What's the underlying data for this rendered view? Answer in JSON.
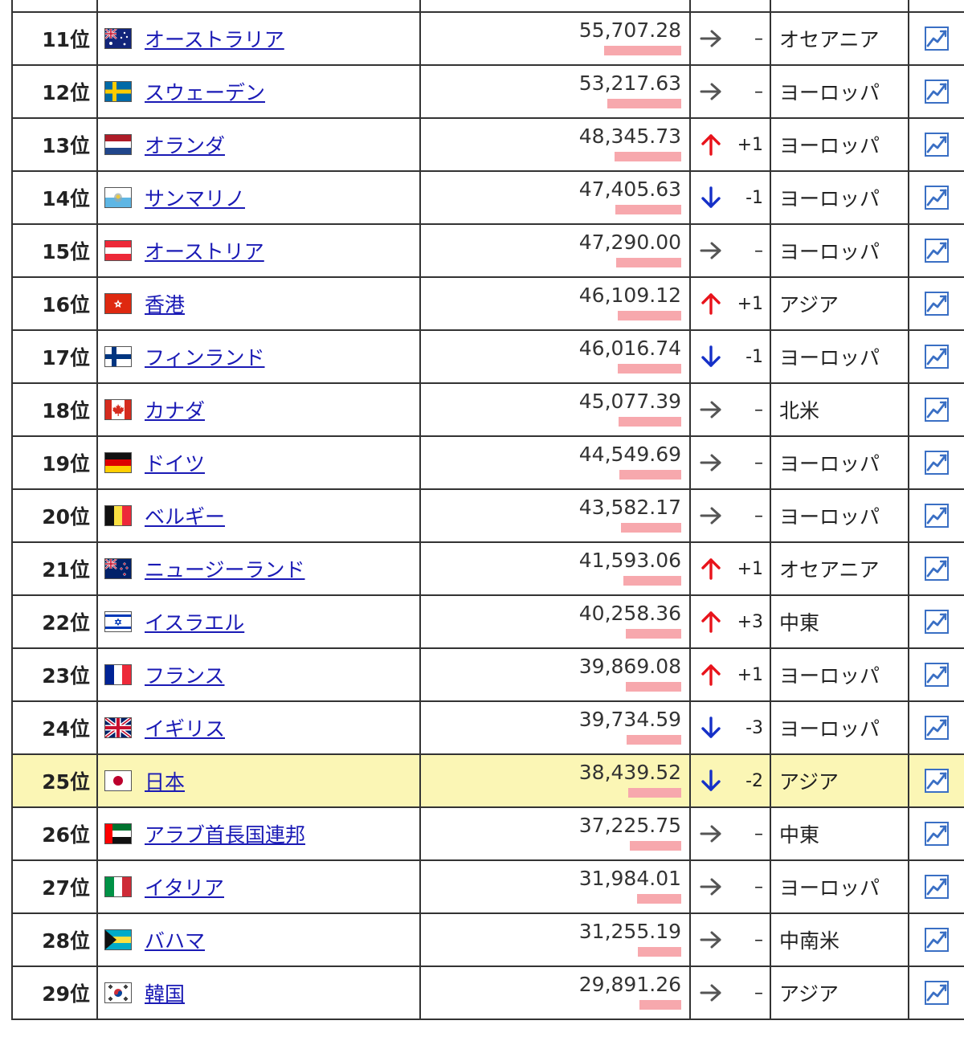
{
  "table": {
    "rows": [
      {
        "rank": "",
        "country": "",
        "value": "",
        "bar_pct": 0,
        "trend": "",
        "change": "",
        "region": "",
        "flag": "",
        "partial": true
      },
      {
        "rank": "11位",
        "country": "オーストラリア",
        "value": "55,707.28",
        "bar_pct": 100,
        "trend": "same",
        "change": "–",
        "region": "オセアニア",
        "flag": "australia-flag-icon"
      },
      {
        "rank": "12位",
        "country": "スウェーデン",
        "value": "53,217.63",
        "bar_pct": 95.5,
        "trend": "same",
        "change": "–",
        "region": "ヨーロッパ",
        "flag": "sweden-flag-icon"
      },
      {
        "rank": "13位",
        "country": "オランダ",
        "value": "48,345.73",
        "bar_pct": 86.8,
        "trend": "up",
        "change": "+1",
        "region": "ヨーロッパ",
        "flag": "netherlands-flag-icon"
      },
      {
        "rank": "14位",
        "country": "サンマリノ",
        "value": "47,405.63",
        "bar_pct": 85.1,
        "trend": "down",
        "change": "-1",
        "region": "ヨーロッパ",
        "flag": "san-marino-flag-icon"
      },
      {
        "rank": "15位",
        "country": "オーストリア",
        "value": "47,290.00",
        "bar_pct": 84.9,
        "trend": "same",
        "change": "–",
        "region": "ヨーロッパ",
        "flag": "austria-flag-icon"
      },
      {
        "rank": "16位",
        "country": "香港",
        "value": "46,109.12",
        "bar_pct": 82.8,
        "trend": "up",
        "change": "+1",
        "region": "アジア",
        "flag": "hong-kong-flag-icon"
      },
      {
        "rank": "17位",
        "country": "フィンランド",
        "value": "46,016.74",
        "bar_pct": 82.6,
        "trend": "down",
        "change": "-1",
        "region": "ヨーロッパ",
        "flag": "finland-flag-icon"
      },
      {
        "rank": "18位",
        "country": "カナダ",
        "value": "45,077.39",
        "bar_pct": 80.9,
        "trend": "same",
        "change": "–",
        "region": "北米",
        "flag": "canada-flag-icon"
      },
      {
        "rank": "19位",
        "country": "ドイツ",
        "value": "44,549.69",
        "bar_pct": 80.0,
        "trend": "same",
        "change": "–",
        "region": "ヨーロッパ",
        "flag": "germany-flag-icon"
      },
      {
        "rank": "20位",
        "country": "ベルギー",
        "value": "43,582.17",
        "bar_pct": 78.2,
        "trend": "same",
        "change": "–",
        "region": "ヨーロッパ",
        "flag": "belgium-flag-icon"
      },
      {
        "rank": "21位",
        "country": "ニュージーランド",
        "value": "41,593.06",
        "bar_pct": 74.7,
        "trend": "up",
        "change": "+1",
        "region": "オセアニア",
        "flag": "new-zealand-flag-icon"
      },
      {
        "rank": "22位",
        "country": "イスラエル",
        "value": "40,258.36",
        "bar_pct": 72.3,
        "trend": "up",
        "change": "+3",
        "region": "中東",
        "flag": "israel-flag-icon"
      },
      {
        "rank": "23位",
        "country": "フランス",
        "value": "39,869.08",
        "bar_pct": 71.6,
        "trend": "up",
        "change": "+1",
        "region": "ヨーロッパ",
        "flag": "france-flag-icon"
      },
      {
        "rank": "24位",
        "country": "イギリス",
        "value": "39,734.59",
        "bar_pct": 71.3,
        "trend": "down",
        "change": "-3",
        "region": "ヨーロッパ",
        "flag": "uk-flag-icon"
      },
      {
        "rank": "25位",
        "country": "日本",
        "value": "38,439.52",
        "bar_pct": 69.0,
        "trend": "down",
        "change": "-2",
        "region": "アジア",
        "flag": "japan-flag-icon",
        "highlight": true
      },
      {
        "rank": "26位",
        "country": "アラブ首長国連邦",
        "value": "37,225.75",
        "bar_pct": 66.8,
        "trend": "same",
        "change": "–",
        "region": "中東",
        "flag": "uae-flag-icon"
      },
      {
        "rank": "27位",
        "country": "イタリア",
        "value": "31,984.01",
        "bar_pct": 57.4,
        "trend": "same",
        "change": "–",
        "region": "ヨーロッパ",
        "flag": "italy-flag-icon"
      },
      {
        "rank": "28位",
        "country": "バハマ",
        "value": "31,255.19",
        "bar_pct": 56.1,
        "trend": "same",
        "change": "–",
        "region": "中南米",
        "flag": "bahamas-flag-icon"
      },
      {
        "rank": "29位",
        "country": "韓国",
        "value": "29,891.26",
        "bar_pct": 53.7,
        "trend": "same",
        "change": "–",
        "region": "アジア",
        "flag": "south-korea-flag-icon"
      }
    ]
  },
  "colors": {
    "link": "#1a1ab5",
    "bar": "#f7a8ad",
    "arrow_up": "#e8131b",
    "arrow_down": "#1530c8",
    "arrow_same": "#555555",
    "highlight_row": "#fbf6b5",
    "chart_icon": "#3a6fc4"
  }
}
